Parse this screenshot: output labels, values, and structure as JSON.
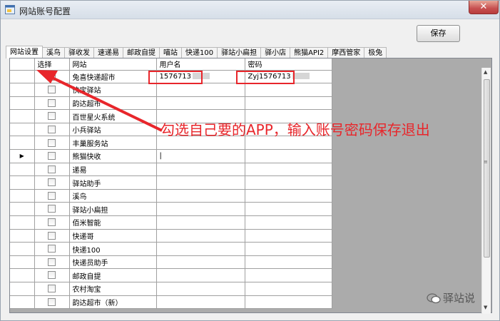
{
  "window": {
    "title": "网站账号配置",
    "close": "✕"
  },
  "toolbar": {
    "save_label": "保存"
  },
  "tabs": [
    "网站设置",
    "溪鸟",
    "驿收发",
    "速递易",
    "邮政自提",
    "喵站",
    "快递100",
    "驿站小扁担",
    "驿小店",
    "熊猫API2",
    "摩西管家",
    "极兔"
  ],
  "grid": {
    "columns": [
      "选择",
      "网站",
      "用户名",
      "密码"
    ],
    "rows": [
      {
        "site": "兔喜快递超市",
        "username": "1576713",
        "password": "Zyj1576713"
      },
      {
        "site": "快宝驿站",
        "username": "",
        "password": ""
      },
      {
        "site": "韵达超市",
        "username": "",
        "password": ""
      },
      {
        "site": "百世星火系统",
        "username": "",
        "password": ""
      },
      {
        "site": "小兵驿站",
        "username": "",
        "password": ""
      },
      {
        "site": "丰巢服务站",
        "username": "",
        "password": ""
      },
      {
        "site": "熊猫快收",
        "username": "",
        "password": ""
      },
      {
        "site": "递易",
        "username": "",
        "password": ""
      },
      {
        "site": "驿站助手",
        "username": "",
        "password": ""
      },
      {
        "site": "溪鸟",
        "username": "",
        "password": ""
      },
      {
        "site": "驿站小扁担",
        "username": "",
        "password": ""
      },
      {
        "site": "佰米智能",
        "username": "",
        "password": ""
      },
      {
        "site": "快递哥",
        "username": "",
        "password": ""
      },
      {
        "site": "快递100",
        "username": "",
        "password": ""
      },
      {
        "site": "快递员助手",
        "username": "",
        "password": ""
      },
      {
        "site": "邮政自提",
        "username": "",
        "password": ""
      },
      {
        "site": "农村淘宝",
        "username": "",
        "password": ""
      },
      {
        "site": "韵达超市（新）",
        "username": "",
        "password": ""
      }
    ]
  },
  "annotation": {
    "text": "勾选自己要的APP，输入账号密码保存退出",
    "color": "#e8262b"
  },
  "watermark": {
    "text": "驿站说"
  },
  "icons": {
    "app": "window-app-icon",
    "current_row": "row-pointer-icon",
    "watermark": "wechat-logo-icon"
  }
}
